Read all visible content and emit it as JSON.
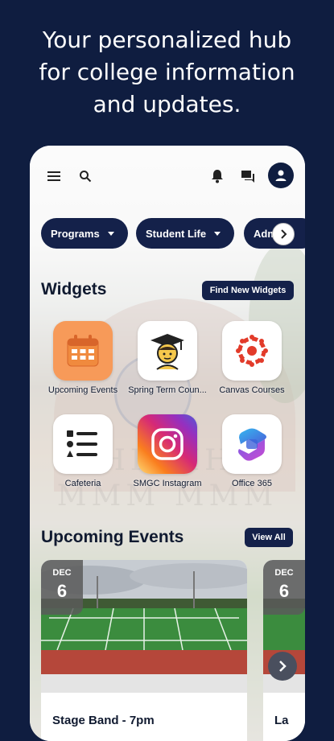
{
  "headline": {
    "line1": "Your personalized hub",
    "line2": "for college information",
    "line3": "and updates."
  },
  "topbar": {
    "icons": [
      "menu-icon",
      "search-icon",
      "bell-icon",
      "chat-icon",
      "account-icon"
    ]
  },
  "chips": [
    {
      "label": "Programs"
    },
    {
      "label": "Student Life"
    },
    {
      "label": "Adm"
    }
  ],
  "widgets_section": {
    "title": "Widgets",
    "find_button": "Find New Widgets",
    "items": [
      {
        "label": "Upcoming Events",
        "icon": "calendar-icon",
        "color": "#f79a59"
      },
      {
        "label": "Spring Term Coun...",
        "icon": "graduate-icon",
        "color": "#ffffff"
      },
      {
        "label": "Canvas Courses",
        "icon": "canvas-icon",
        "color": "#ffffff"
      },
      {
        "label": "Cafeteria",
        "icon": "list-icon",
        "color": "#ffffff"
      },
      {
        "label": "SMGC Instagram",
        "icon": "instagram-icon",
        "color": "#d62976"
      },
      {
        "label": "Office 365",
        "icon": "office365-icon",
        "color": "#ffffff"
      }
    ]
  },
  "events_section": {
    "title": "Upcoming Events",
    "view_all": "View All",
    "events": [
      {
        "month": "DEC",
        "day": "6",
        "title": "Stage Band - 7pm"
      },
      {
        "month": "DEC",
        "day": "6",
        "title": "La"
      }
    ]
  },
  "colors": {
    "navy": "#0f1d40",
    "chip": "#14214a"
  }
}
